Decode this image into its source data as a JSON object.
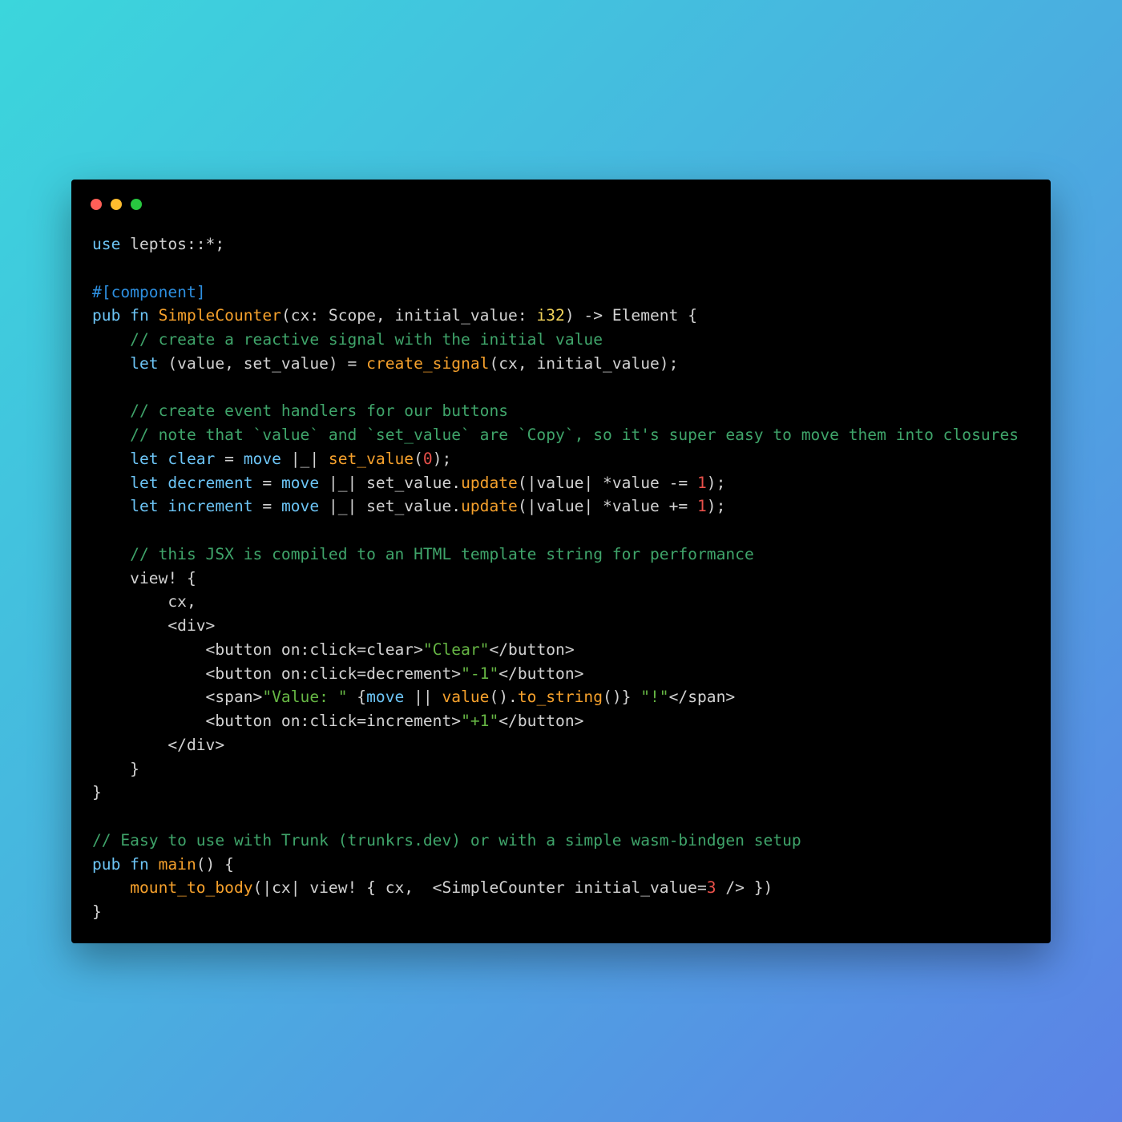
{
  "window": {
    "controls": [
      {
        "name": "close",
        "color": "#ff5f57"
      },
      {
        "name": "minimize",
        "color": "#febc2e"
      },
      {
        "name": "maximize",
        "color": "#28c840"
      }
    ]
  },
  "colors": {
    "keyword": "#6cc4f5",
    "function": "#f6a12c",
    "comment": "#3fa46a",
    "string": "#66b644",
    "number": "#e8504a",
    "type": "#f3d35a",
    "attribute": "#2d8fe0",
    "plain": "#d2d2d2"
  },
  "code": [
    [
      [
        "k",
        "use"
      ],
      [
        "p",
        " leptos::*;"
      ]
    ],
    [],
    [
      [
        "a",
        "#[component]"
      ]
    ],
    [
      [
        "k",
        "pub fn "
      ],
      [
        "f",
        "SimpleCounter"
      ],
      [
        "p",
        "(cx: Scope, initial_value: "
      ],
      [
        "t",
        "i32"
      ],
      [
        "p",
        ") -> Element {"
      ]
    ],
    [
      [
        "c",
        "    // create a reactive signal with the initial value"
      ]
    ],
    [
      [
        "p",
        "    "
      ],
      [
        "k",
        "let"
      ],
      [
        "p",
        " (value, set_value) = "
      ],
      [
        "f",
        "create_signal"
      ],
      [
        "p",
        "(cx, initial_value);"
      ]
    ],
    [],
    [
      [
        "c",
        "    // create event handlers for our buttons"
      ]
    ],
    [
      [
        "c",
        "    // note that `value` and `set_value` are `Copy`, so it's super easy to move them into closures"
      ]
    ],
    [
      [
        "p",
        "    "
      ],
      [
        "k",
        "let clear"
      ],
      [
        "p",
        " = "
      ],
      [
        "k",
        "move"
      ],
      [
        "p",
        " |_| "
      ],
      [
        "f",
        "set_value"
      ],
      [
        "p",
        "("
      ],
      [
        "n",
        "0"
      ],
      [
        "p",
        ");"
      ]
    ],
    [
      [
        "p",
        "    "
      ],
      [
        "k",
        "let decrement"
      ],
      [
        "p",
        " = "
      ],
      [
        "k",
        "move"
      ],
      [
        "p",
        " |_| set_value."
      ],
      [
        "f",
        "update"
      ],
      [
        "p",
        "(|value| *value -= "
      ],
      [
        "n",
        "1"
      ],
      [
        "p",
        ");"
      ]
    ],
    [
      [
        "p",
        "    "
      ],
      [
        "k",
        "let increment"
      ],
      [
        "p",
        " = "
      ],
      [
        "k",
        "move"
      ],
      [
        "p",
        " |_| set_value."
      ],
      [
        "f",
        "update"
      ],
      [
        "p",
        "(|value| *value += "
      ],
      [
        "n",
        "1"
      ],
      [
        "p",
        ");"
      ]
    ],
    [],
    [
      [
        "c",
        "    // this JSX is compiled to an HTML template string for performance"
      ]
    ],
    [
      [
        "p",
        "    view! {"
      ]
    ],
    [
      [
        "p",
        "        cx,"
      ]
    ],
    [
      [
        "p",
        "        <div>"
      ]
    ],
    [
      [
        "p",
        "            <button on:click=clear>"
      ],
      [
        "s",
        "\"Clear\""
      ],
      [
        "p",
        "</button>"
      ]
    ],
    [
      [
        "p",
        "            <button on:click=decrement>"
      ],
      [
        "s",
        "\"-1\""
      ],
      [
        "p",
        "</button>"
      ]
    ],
    [
      [
        "p",
        "            <span>"
      ],
      [
        "s",
        "\"Value: \""
      ],
      [
        "p",
        " {"
      ],
      [
        "k",
        "move"
      ],
      [
        "p",
        " || "
      ],
      [
        "f",
        "value"
      ],
      [
        "p",
        "()."
      ],
      [
        "f",
        "to_string"
      ],
      [
        "p",
        "()} "
      ],
      [
        "s",
        "\"!\""
      ],
      [
        "p",
        "</span>"
      ]
    ],
    [
      [
        "p",
        "            <button on:click=increment>"
      ],
      [
        "s",
        "\"+1\""
      ],
      [
        "p",
        "</button>"
      ]
    ],
    [
      [
        "p",
        "        </div>"
      ]
    ],
    [
      [
        "p",
        "    }"
      ]
    ],
    [
      [
        "p",
        "}"
      ]
    ],
    [],
    [
      [
        "c",
        "// Easy to use with Trunk (trunkrs.dev) or with a simple wasm-bindgen setup"
      ]
    ],
    [
      [
        "k",
        "pub fn "
      ],
      [
        "f",
        "main"
      ],
      [
        "p",
        "() {"
      ]
    ],
    [
      [
        "p",
        "    "
      ],
      [
        "f",
        "mount_to_body"
      ],
      [
        "p",
        "(|cx| view! { cx,  <SimpleCounter initial_value="
      ],
      [
        "n",
        "3"
      ],
      [
        "p",
        " /> })"
      ]
    ],
    [
      [
        "p",
        "}"
      ]
    ]
  ]
}
